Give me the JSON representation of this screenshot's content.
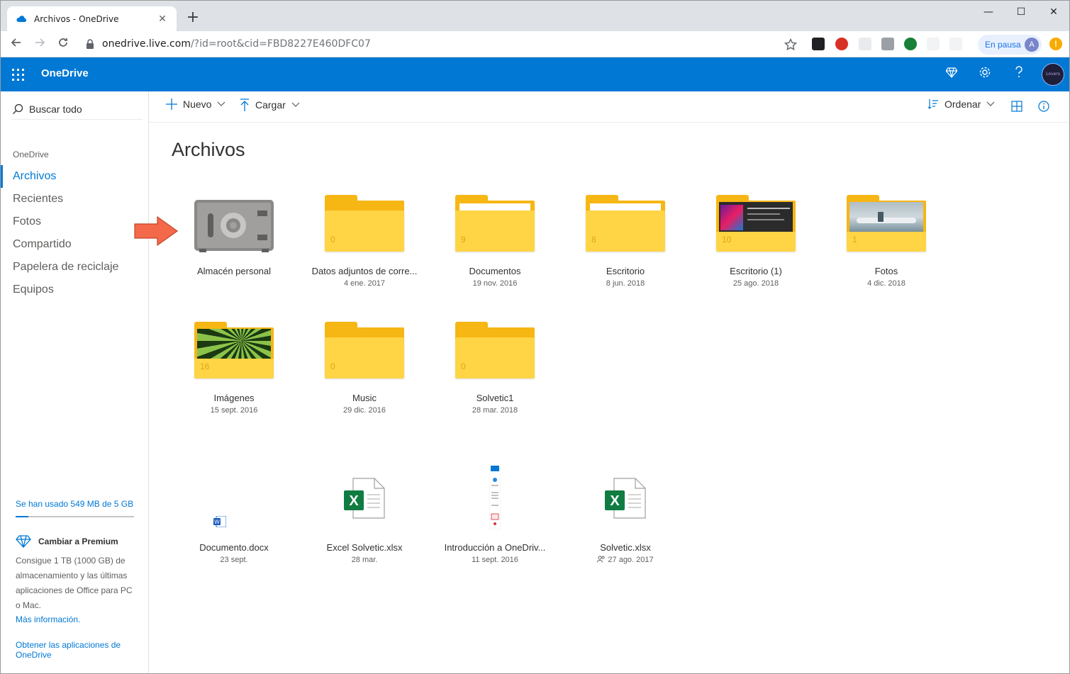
{
  "browser": {
    "tab_title": "Archivos - OneDrive",
    "tab_close": "✕",
    "new_tab": "+",
    "url_host": "onedrive.live.com",
    "url_rest": "/?id=root&cid=FBD8227E460DFC07",
    "profile_pill": "En pausa",
    "profile_initial": "A",
    "alert": "!",
    "window_minimize": "—",
    "window_maximize": "☐",
    "window_close": "✕"
  },
  "header": {
    "brand": "OneDrive",
    "avatar_text": "Lovers"
  },
  "leftnav": {
    "search_label": "Buscar todo",
    "section": "OneDrive",
    "items": [
      {
        "label": "Archivos",
        "active": true
      },
      {
        "label": "Recientes",
        "active": false
      },
      {
        "label": "Fotos",
        "active": false
      },
      {
        "label": "Compartido",
        "active": false
      },
      {
        "label": "Papelera de reciclaje",
        "active": false
      },
      {
        "label": "Equipos",
        "active": false
      }
    ],
    "storage_text": "Se han usado 549 MB de 5 GB",
    "storage_fraction": 0.107,
    "premium_title": "Cambiar a Premium",
    "premium_desc": "Consigue 1 TB (1000 GB) de almacenamiento y las últimas aplicaciones de Office para PC o Mac.",
    "more_info": "Más información.",
    "get_apps": "Obtener las aplicaciones de OneDrive"
  },
  "command_bar": {
    "new_label": "Nuevo",
    "upload_label": "Cargar",
    "sort_label": "Ordenar"
  },
  "page_title": "Archivos",
  "items": [
    {
      "name": "Almacén personal",
      "date": "",
      "kind": "vault"
    },
    {
      "name": "Datos adjuntos de corre...",
      "date": "4 ene. 2017",
      "kind": "folder",
      "count": "0"
    },
    {
      "name": "Documentos",
      "date": "19 nov. 2016",
      "kind": "folder",
      "count": "9"
    },
    {
      "name": "Escritorio",
      "date": "8 jun. 2018",
      "kind": "folder",
      "count": "8"
    },
    {
      "name": "Escritorio (1)",
      "date": "25 ago. 2018",
      "kind": "folder",
      "count": "10"
    },
    {
      "name": "Fotos",
      "date": "4 dic. 2018",
      "kind": "folder",
      "count": "1"
    },
    {
      "name": "Imágenes",
      "date": "15 sept. 2016",
      "kind": "folder",
      "count": "16"
    },
    {
      "name": "Music",
      "date": "29 dic. 2016",
      "kind": "folder",
      "count": "0"
    },
    {
      "name": "Solvetic1",
      "date": "28 mar. 2018",
      "kind": "folder",
      "count": "0"
    },
    {
      "name": "Documento.docx",
      "date": "23 sept.",
      "kind": "word"
    },
    {
      "name": "Excel Solvetic.xlsx",
      "date": "28 mar.",
      "kind": "excel"
    },
    {
      "name": "Introducción a OneDriv...",
      "date": "11 sept. 2016",
      "kind": "pdf"
    },
    {
      "name": "Solvetic.xlsx",
      "date": "27 ago. 2017",
      "kind": "excel",
      "shared": true
    }
  ],
  "colors": {
    "brand_blue": "#0078d4",
    "folder_front": "#ffd445",
    "folder_back": "#f6b614",
    "excel_green": "#107c41",
    "word_blue": "#185abd",
    "callout_arrow": "#f4694a"
  }
}
